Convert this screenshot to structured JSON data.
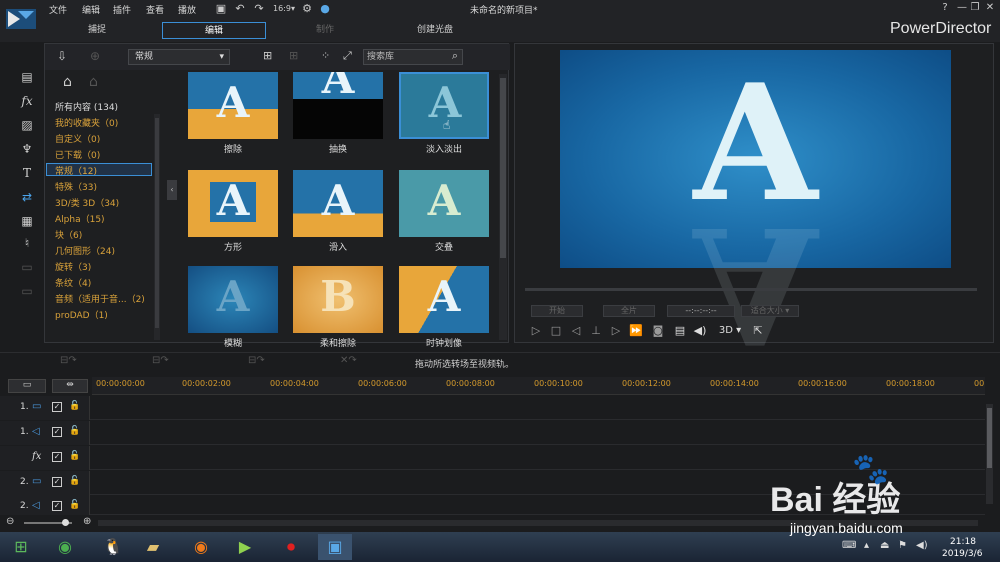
{
  "menu": [
    "文件",
    "编辑",
    "插件",
    "查看",
    "播放"
  ],
  "document_title": "未命名的新项目*",
  "modes": [
    "捕捉",
    "编辑",
    "制作",
    "创建光盘"
  ],
  "brand": "PowerDirector",
  "library": {
    "category_select": "常规",
    "search_placeholder": "搜索库",
    "categories": [
      "所有内容 (134)",
      "我的收藏夹（0)",
      "自定义（0)",
      "已下载（0)",
      "常规（12)",
      "特殊（33)",
      "3D/类 3D（34)",
      "Alpha（15)",
      "块（6)",
      "几何图形（24)",
      "旋转（3)",
      "条纹（4)",
      "音频（适用于音...（2)",
      "proDAD（1)"
    ],
    "selected_category_index": 4,
    "thumbs": [
      {
        "label": "擦除"
      },
      {
        "label": "抽换"
      },
      {
        "label": "淡入淡出"
      },
      {
        "label": "方形"
      },
      {
        "label": "滑入"
      },
      {
        "label": "交叠"
      },
      {
        "label": "模糊"
      },
      {
        "label": "柔和擦除"
      },
      {
        "label": "时钟划像"
      }
    ]
  },
  "preview": {
    "letter": "A",
    "btn_inpoint": "开始",
    "btn_outpoint": "全片",
    "timecode": "--:--:--:--",
    "zoom": "适合大小",
    "mode3d": "3D"
  },
  "timeline": {
    "hint": "拖动所选转场至视频轨。",
    "ruler": [
      "00:00:00:00",
      "00:00:02:00",
      "00:00:04:00",
      "00:00:06:00",
      "00:00:08:00",
      "00:00:10:00",
      "00:00:12:00",
      "00:00:14:00",
      "00:00:16:00",
      "00:00:18:00",
      "00"
    ],
    "tracks": [
      {
        "num": "1.",
        "icon": "video-track-icon",
        "glyph": "▭"
      },
      {
        "num": "1.",
        "icon": "audio-track-icon",
        "glyph": "◁"
      },
      {
        "num": "",
        "icon": "fx-track-icon",
        "glyph": "fx"
      },
      {
        "num": "2.",
        "icon": "video-track-icon",
        "glyph": "▭"
      },
      {
        "num": "2.",
        "icon": "audio-track-icon",
        "glyph": "◁"
      }
    ]
  },
  "taskbar": {
    "time": "21:18",
    "date": "2019/3/6"
  },
  "watermark": {
    "text": "Bai 经验",
    "url": "jingyan.baidu.com"
  }
}
